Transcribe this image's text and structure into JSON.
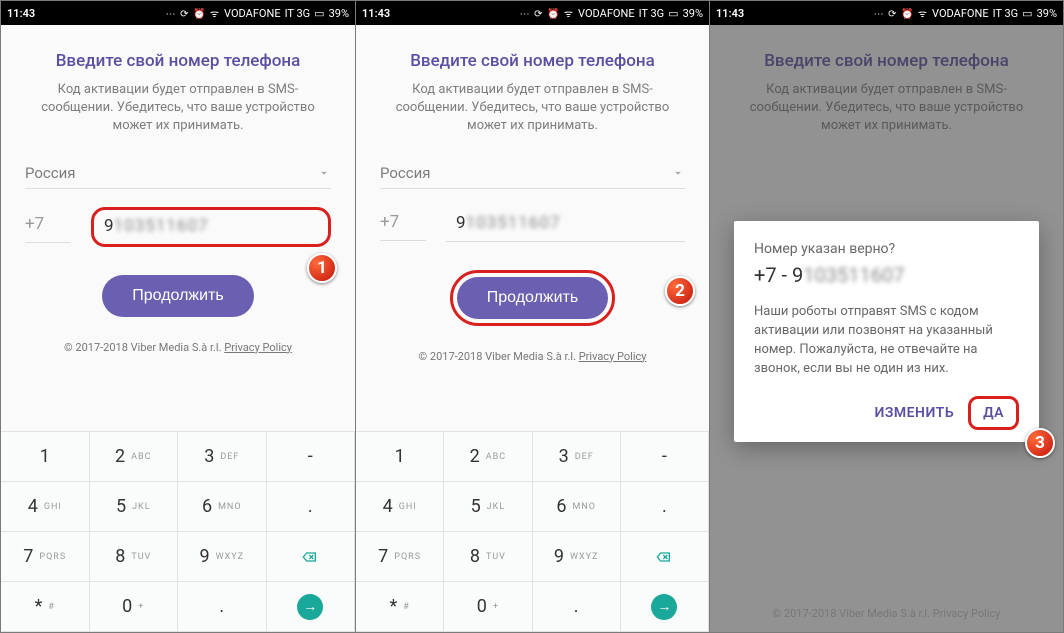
{
  "status": {
    "time": "11:43",
    "icons": "⋯ ⟳ ⏰ �ных",
    "carrier": "VODAFONE",
    "network": "IT 3G",
    "battery": "39%"
  },
  "screen": {
    "title": "Введите свой номер телефона",
    "subtitle": "Код активации будет отправлен в SMS-сообщении. Убедитесь, что ваше устройство может их принимать.",
    "country": "Россия",
    "dialcode": "+7",
    "number_lead": "9",
    "number_rest": "103511607",
    "continue": "Продолжить",
    "footer_prefix": "© 2017-2018 Viber Media S.à r.l. ",
    "footer_link": "Privacy Policy"
  },
  "keypad": {
    "rows": [
      [
        {
          "m": "1",
          "s": ""
        },
        {
          "m": "2",
          "s": "ABC"
        },
        {
          "m": "3",
          "s": "DEF"
        },
        {
          "m": "-",
          "s": "",
          "action": true
        }
      ],
      [
        {
          "m": "4",
          "s": "GHI"
        },
        {
          "m": "5",
          "s": "JKL"
        },
        {
          "m": "6",
          "s": "MNO"
        },
        {
          "m": ".",
          "s": "",
          "action": true
        }
      ],
      [
        {
          "m": "7",
          "s": "PQRS"
        },
        {
          "m": "8",
          "s": "TUV"
        },
        {
          "m": "9",
          "s": "WXYZ"
        },
        {
          "bksp": true
        }
      ],
      [
        {
          "m": "*",
          "s": "#"
        },
        {
          "m": "0",
          "s": "+"
        },
        {
          "m": ".",
          "s": ""
        },
        {
          "go": true
        }
      ]
    ]
  },
  "dialog": {
    "question": "Номер указан верно?",
    "number_prefix": "+7 - ",
    "number_lead": "9",
    "number_rest": "103511607",
    "desc": "Наши роботы отправят SMS с кодом активации или позвонят на указанный номер. Пожалуйста, не отвечайте на звонок, если вы не один из них.",
    "change": "ИЗМЕНИТЬ",
    "yes": "ДА"
  },
  "badges": {
    "b1": "1",
    "b2": "2",
    "b3": "3"
  }
}
